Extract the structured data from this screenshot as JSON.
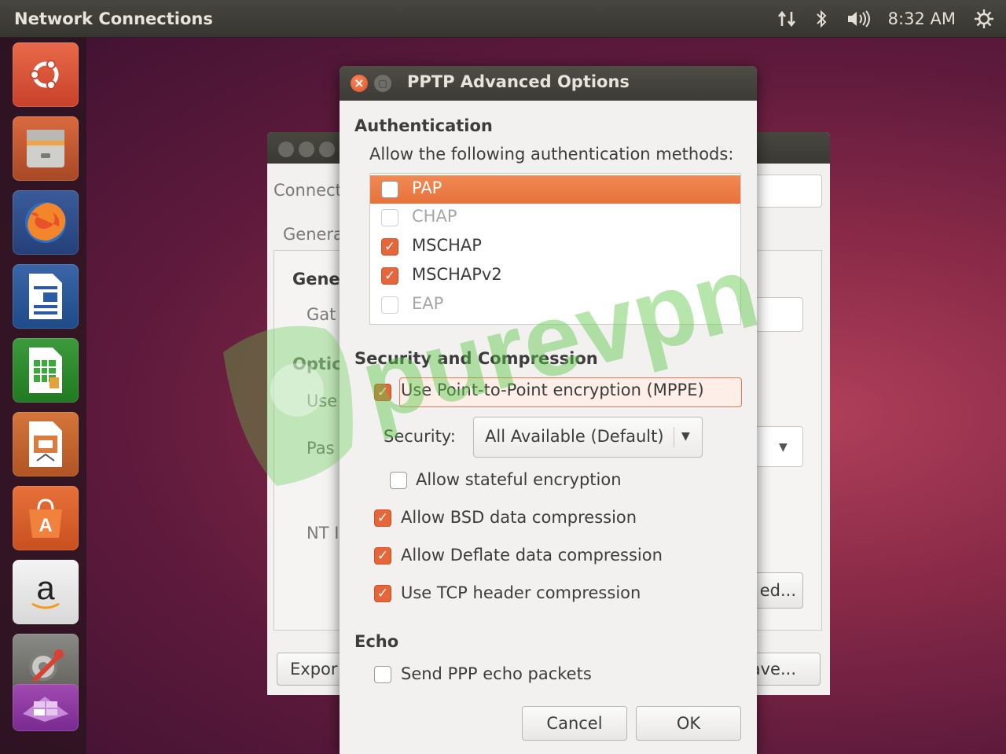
{
  "top_panel": {
    "title": "Network Connections",
    "clock": "8:32 AM",
    "icons": [
      "network-transfer-icon",
      "bluetooth-icon",
      "volume-icon",
      "power-gear-icon"
    ]
  },
  "launcher": {
    "items": [
      "ubuntu-dash-icon",
      "files-icon",
      "firefox-icon",
      "writer-icon",
      "calc-icon",
      "impress-icon",
      "software-center-icon",
      "amazon-icon",
      "system-settings-icon",
      "workspace-switcher-icon"
    ],
    "amazon_glyph": "a"
  },
  "background_dialog": {
    "labels": [
      "Connect",
      "Genera",
      "Gene",
      "Gat",
      "Optic",
      "Use",
      "Pas",
      "NT I"
    ],
    "advanced_button": "ed...",
    "export_button": "Expor",
    "save_button": "ave..."
  },
  "dialog": {
    "title": "PPTP Advanced Options",
    "authentication": {
      "heading": "Authentication",
      "description": "Allow the following authentication methods:",
      "methods": [
        {
          "label": "PAP",
          "checked": false,
          "selected": true,
          "disabled": false
        },
        {
          "label": "CHAP",
          "checked": false,
          "selected": false,
          "disabled": true
        },
        {
          "label": "MSCHAP",
          "checked": true,
          "selected": false,
          "disabled": false
        },
        {
          "label": "MSCHAPv2",
          "checked": true,
          "selected": false,
          "disabled": false
        },
        {
          "label": "EAP",
          "checked": false,
          "selected": false,
          "disabled": true
        }
      ]
    },
    "security": {
      "heading": "Security and Compression",
      "mppe": "Use Point-to-Point encryption (MPPE)",
      "security_label": "Security:",
      "security_value": "All Available (Default)",
      "stateful": "Allow stateful encryption",
      "bsd": "Allow BSD data compression",
      "deflate": "Allow Deflate data compression",
      "tcp": "Use TCP header compression"
    },
    "echo": {
      "heading": "Echo",
      "send_echo": "Send PPP echo packets"
    },
    "buttons": {
      "cancel": "Cancel",
      "ok": "OK"
    }
  },
  "watermark": {
    "text": "purevpn",
    "colors": {
      "green": "#5ec94a",
      "purple": "#6f5bd6"
    }
  }
}
